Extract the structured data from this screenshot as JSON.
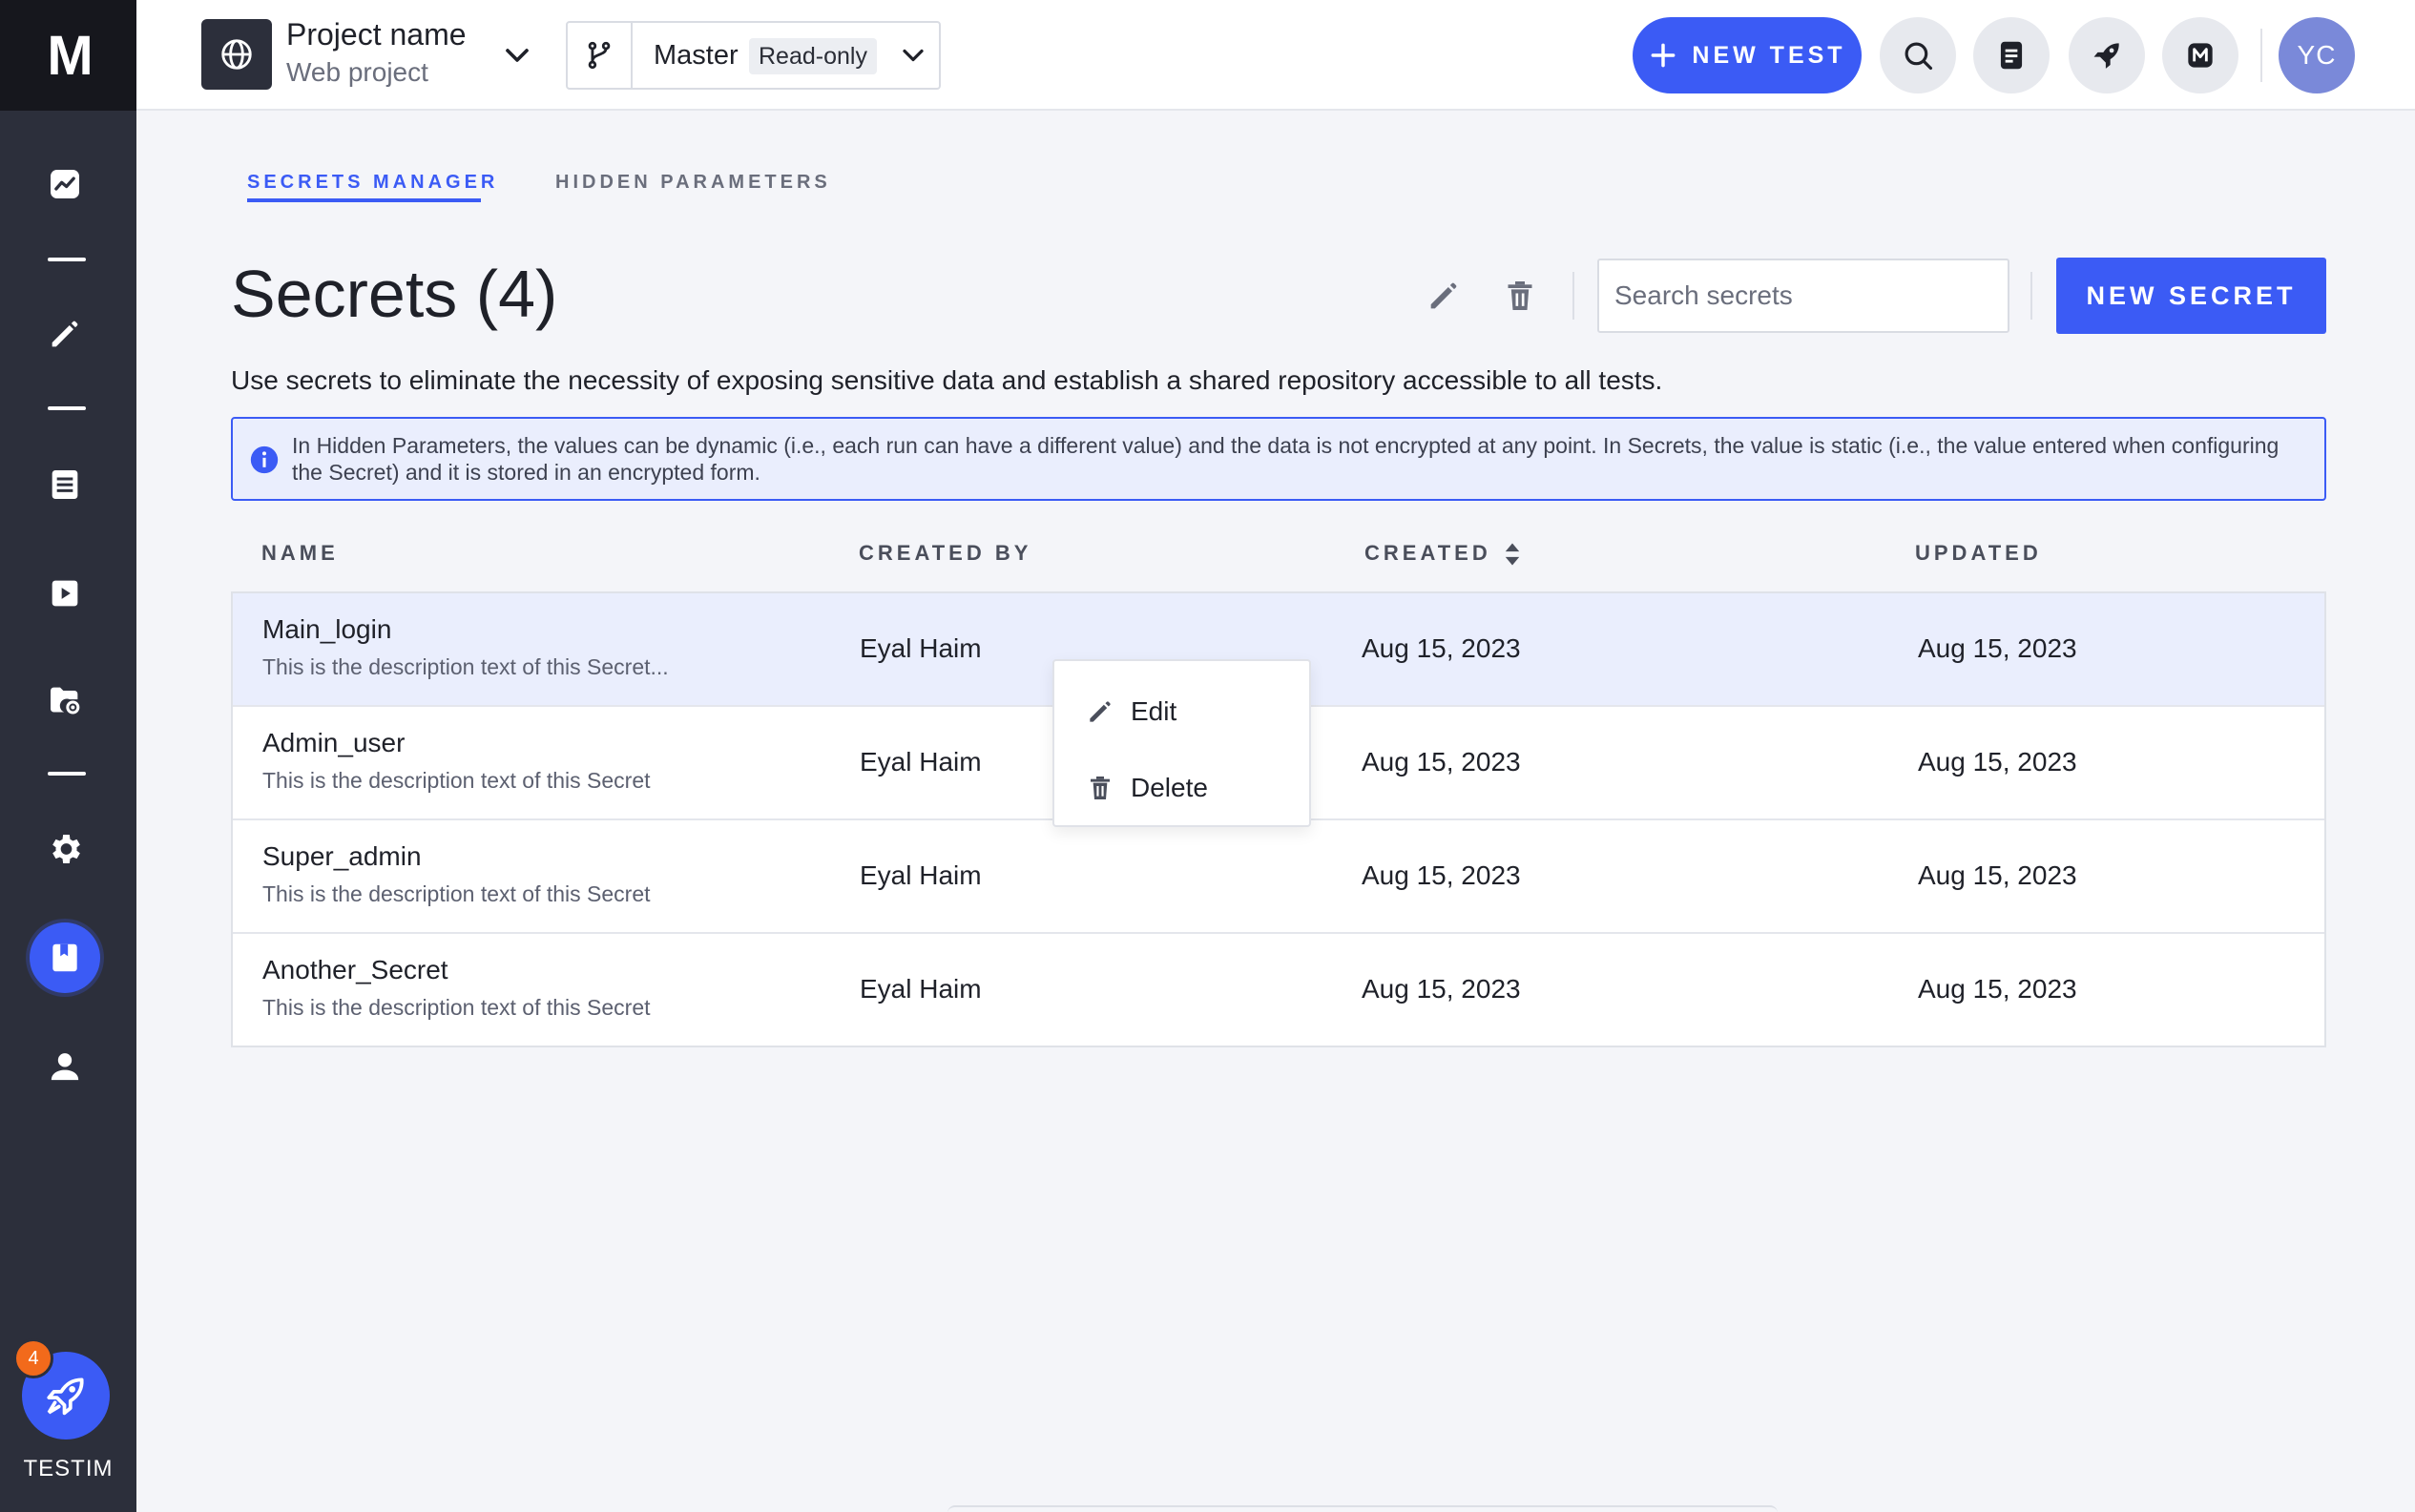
{
  "brand": {
    "logo": "M"
  },
  "sidebar": {
    "items": [
      {
        "icon": "analytics-icon"
      },
      {
        "icon": "edit-icon"
      },
      {
        "icon": "list-icon"
      },
      {
        "icon": "play-icon"
      },
      {
        "icon": "folder-settings-icon"
      },
      {
        "icon": "gear-icon"
      },
      {
        "icon": "bookmark-icon",
        "active": true
      },
      {
        "icon": "user-icon"
      }
    ],
    "rocket": {
      "badge": "4",
      "label": "TESTIM"
    }
  },
  "topbar": {
    "project_name": "Project name",
    "project_type": "Web project",
    "branch": "Master",
    "branch_badge": "Read-only",
    "new_test_label": "NEW TEST",
    "avatar_initials": "YC"
  },
  "tabs": [
    {
      "label": "SECRETS MANAGER",
      "active": true
    },
    {
      "label": "HIDDEN PARAMETERS",
      "active": false
    }
  ],
  "page": {
    "title": "Secrets (4)",
    "search_placeholder": "Search secrets",
    "new_secret_label": "NEW SECRET",
    "intro": "Use secrets to eliminate the necessity of exposing sensitive data and establish a shared repository accessible to all tests.",
    "info": "In Hidden Parameters, the values can be dynamic (i.e., each run can have a different value) and the data is not encrypted at any point. In Secrets, the value is static (i.e., the value entered when configuring the Secret) and it is stored in an encrypted form."
  },
  "table": {
    "headers": {
      "name": "NAME",
      "created_by": "CREATED BY",
      "created": "CREATED",
      "updated": "UPDATED"
    },
    "rows": [
      {
        "name": "Main_login",
        "description": "This is the description text of this Secret...",
        "created_by": "Eyal Haim",
        "created": "Aug 15, 2023",
        "updated": "Aug 15, 2023"
      },
      {
        "name": "Admin_user",
        "description": "This is the description text of this Secret",
        "created_by": "Eyal Haim",
        "created": "Aug 15, 2023",
        "updated": "Aug 15, 2023"
      },
      {
        "name": "Super_admin",
        "description": "This is the description text of this Secret",
        "created_by": "Eyal Haim",
        "created": "Aug 15, 2023",
        "updated": "Aug 15, 2023"
      },
      {
        "name": "Another_Secret",
        "description": "This is the description text of this Secret",
        "created_by": "Eyal Haim",
        "created": "Aug 15, 2023",
        "updated": "Aug 15, 2023"
      }
    ]
  },
  "context_menu": {
    "edit": "Edit",
    "delete": "Delete"
  },
  "colors": {
    "accent": "#3b5bf5",
    "sidebar": "#2c2f3b",
    "badge": "#f26a1b"
  }
}
